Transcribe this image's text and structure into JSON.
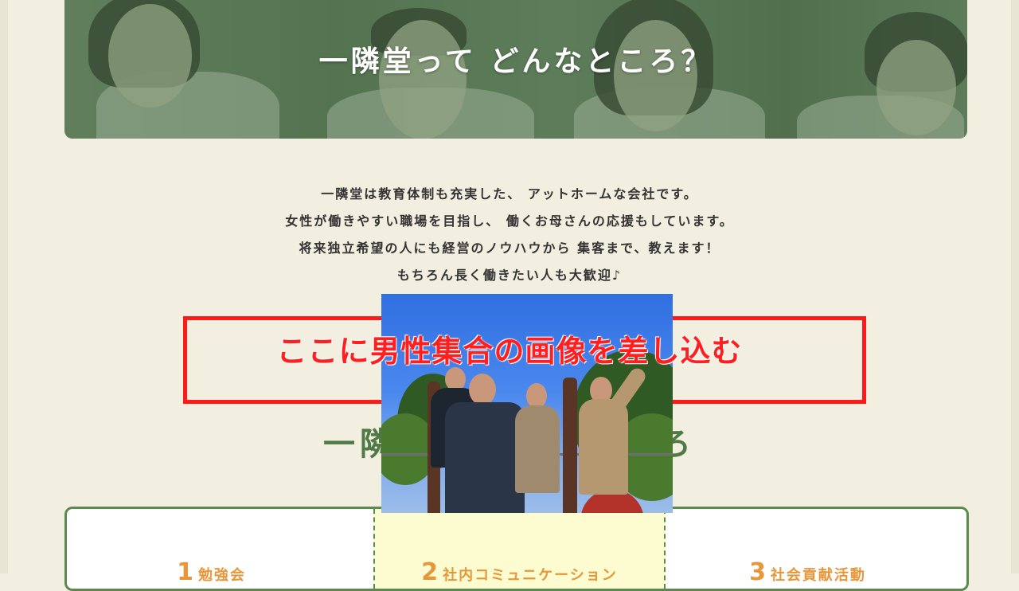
{
  "hero": {
    "title": "一隣堂って どんなところ？"
  },
  "intro": {
    "lines": [
      "一隣堂は教育体制も充実した、 アットホームな会社です。",
      "女性が働きやすい職場を目指し、 働くお母さんの応援もしています。",
      "将来独立希望の人にも経営のノウハウから 集客まで、教えます！",
      "もちろん長く働きたい人も大歓迎♪"
    ]
  },
  "placeholder": {
    "text": "ここに男性集合の画像を差し込む",
    "color": "#ff1a1a"
  },
  "section": {
    "heading_visible_left": "一隣",
    "heading_visible_right": "ろ"
  },
  "cards": [
    {
      "number": "1",
      "label": "勉強会"
    },
    {
      "number": "2",
      "label": "社内コミュニケーション"
    },
    {
      "number": "3",
      "label": "社会貢献活動"
    }
  ],
  "colors": {
    "background": "#f2efe1",
    "accent_green": "#5b8a50",
    "accent_orange": "#e8963a",
    "highlight_card": "#fdfbd0"
  }
}
